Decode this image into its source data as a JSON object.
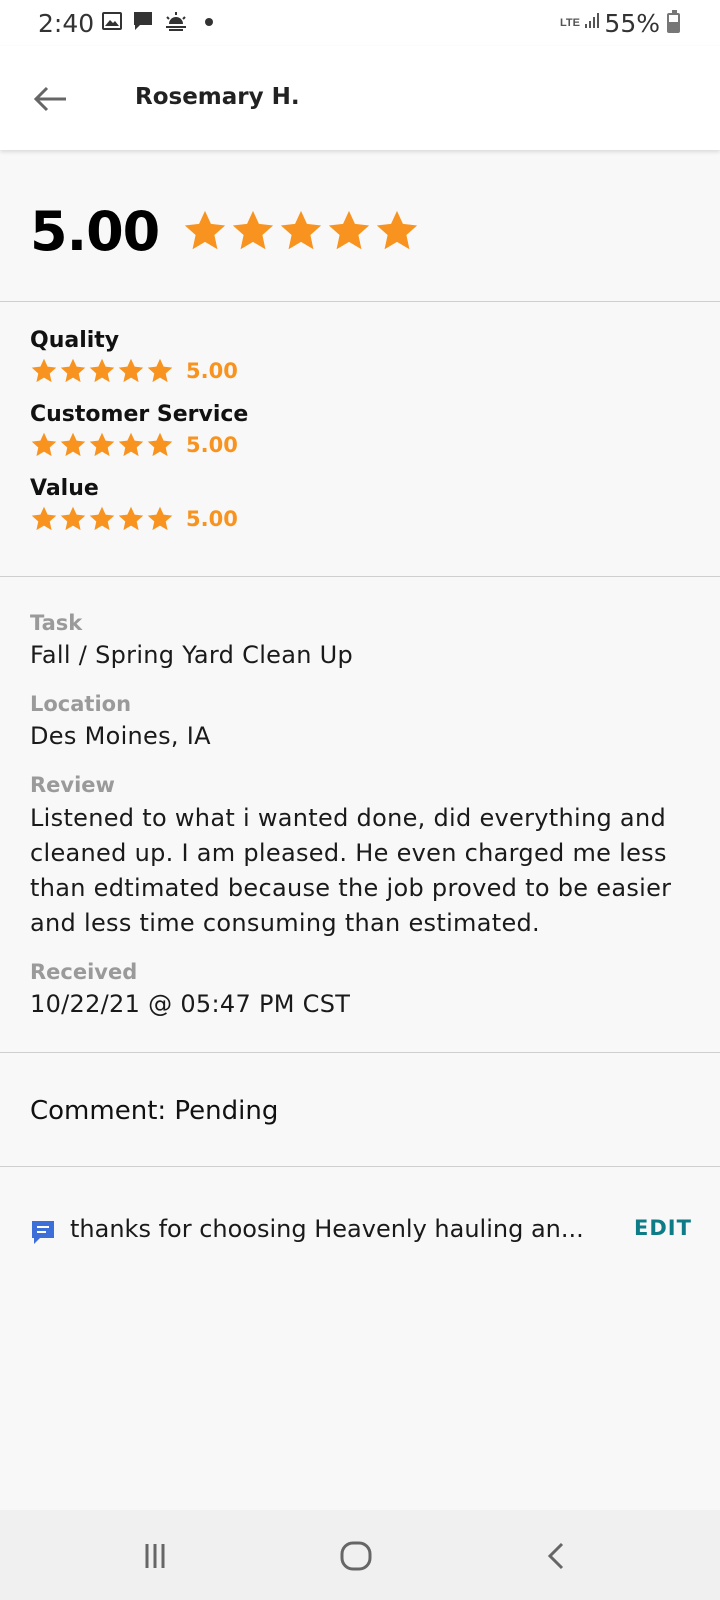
{
  "status_bar": {
    "time": "2:40",
    "network": "LTE",
    "battery_percent": "55%",
    "battery_level": 0.55,
    "icons": [
      "gallery-icon",
      "message-icon",
      "weather-icon",
      "dot-icon"
    ]
  },
  "header": {
    "title": "Rosemary H."
  },
  "overall": {
    "score": "5.00",
    "stars": 5
  },
  "categories": [
    {
      "label": "Quality",
      "score": "5.00",
      "stars": 5
    },
    {
      "label": "Customer Service",
      "score": "5.00",
      "stars": 5
    },
    {
      "label": "Value",
      "score": "5.00",
      "stars": 5
    }
  ],
  "details": {
    "task_label": "Task",
    "task_value": "Fall / Spring Yard Clean Up",
    "location_label": "Location",
    "location_value": "Des Moines, IA",
    "review_label": "Review",
    "review_value": "Listened to what i wanted done, did everything and cleaned up. I am pleased. He even charged me less than edtimated because the job proved to be easier and less time consuming than estimated.",
    "received_label": "Received",
    "received_value": "10/22/21 @ 05:47 PM CST"
  },
  "comment": {
    "status": "Comment: Pending",
    "text": "thanks for choosing Heavenly hauling an...",
    "edit_label": "EDIT"
  },
  "colors": {
    "star": "#f7931e",
    "accent": "#0e7c86",
    "comment_icon": "#3d6fd8"
  }
}
